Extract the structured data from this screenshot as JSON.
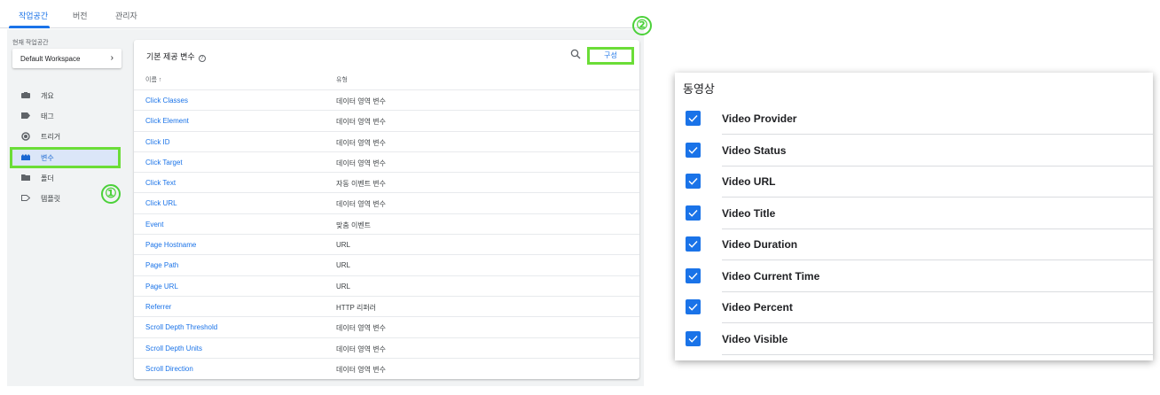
{
  "topnav": {
    "tabs": [
      {
        "label": "작업공간",
        "active": true
      },
      {
        "label": "버전",
        "active": false
      },
      {
        "label": "관리자",
        "active": false
      }
    ]
  },
  "workspace": {
    "label": "현재 작업공간",
    "value": "Default Workspace"
  },
  "sidebar": {
    "items": [
      {
        "label": "개요",
        "icon": "briefcase-icon"
      },
      {
        "label": "태그",
        "icon": "tag-icon"
      },
      {
        "label": "트리거",
        "icon": "trigger-icon"
      },
      {
        "label": "변수",
        "icon": "variables-icon",
        "active": true
      },
      {
        "label": "폴더",
        "icon": "folder-icon"
      },
      {
        "label": "템플릿",
        "icon": "template-icon"
      }
    ]
  },
  "annotations": {
    "one": "①",
    "two": "②"
  },
  "card": {
    "title": "기본 제공 변수",
    "help": "?",
    "config_label": "구성",
    "col_name": "이름 ↑",
    "col_type": "유형",
    "rows": [
      {
        "name": "Click Classes",
        "type": "데이터 영역 변수"
      },
      {
        "name": "Click Element",
        "type": "데이터 영역 변수"
      },
      {
        "name": "Click ID",
        "type": "데이터 영역 변수"
      },
      {
        "name": "Click Target",
        "type": "데이터 영역 변수"
      },
      {
        "name": "Click Text",
        "type": "자동 이벤트 변수"
      },
      {
        "name": "Click URL",
        "type": "데이터 영역 변수"
      },
      {
        "name": "Event",
        "type": "맞춤 이벤트"
      },
      {
        "name": "Page Hostname",
        "type": "URL"
      },
      {
        "name": "Page Path",
        "type": "URL"
      },
      {
        "name": "Page URL",
        "type": "URL"
      },
      {
        "name": "Referrer",
        "type": "HTTP 리퍼러"
      },
      {
        "name": "Scroll Depth Threshold",
        "type": "데이터 영역 변수"
      },
      {
        "name": "Scroll Depth Units",
        "type": "데이터 영역 변수"
      },
      {
        "name": "Scroll Direction",
        "type": "데이터 영역 변수"
      }
    ]
  },
  "video": {
    "title": "동영상",
    "items": [
      {
        "label": "Video Provider",
        "checked": true
      },
      {
        "label": "Video Status",
        "checked": true
      },
      {
        "label": "Video URL",
        "checked": true
      },
      {
        "label": "Video Title",
        "checked": true
      },
      {
        "label": "Video Duration",
        "checked": true
      },
      {
        "label": "Video Current Time",
        "checked": true
      },
      {
        "label": "Video Percent",
        "checked": true
      },
      {
        "label": "Video Visible",
        "checked": true
      }
    ]
  },
  "colors": {
    "accent": "#1a73e8",
    "highlight": "#6bdd37",
    "active_bg": "#dbe6f8"
  }
}
